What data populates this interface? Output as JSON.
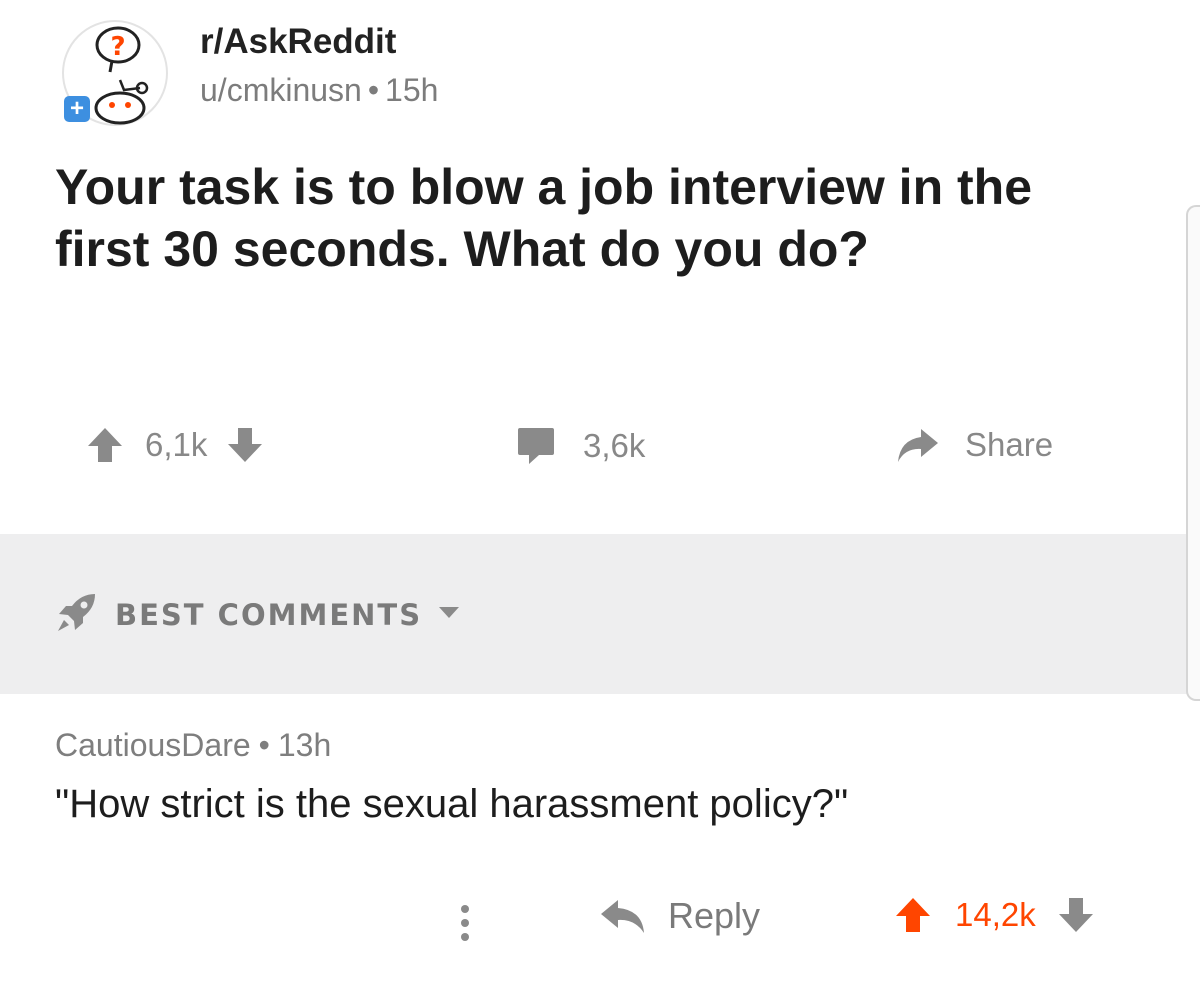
{
  "post": {
    "subreddit": "r/AskReddit",
    "author": "u/cmkinusn",
    "separator": "•",
    "age": "15h",
    "title": "Your task is to blow a job interview in the first 30 seconds. What do you do?",
    "score": "6,1k",
    "comments_count": "3,6k",
    "share_label": "Share"
  },
  "sort": {
    "label": "BEST COMMENTS"
  },
  "comment": {
    "author": "CautiousDare",
    "separator": "•",
    "age": "13h",
    "body": "\"How strict is the sexual harassment policy?\"",
    "reply_label": "Reply",
    "score": "14,2k"
  },
  "colors": {
    "upvote_active": "#ff4500",
    "icon_gray": "#8a8a8a",
    "sort_bar_bg": "#eeeeef",
    "plus_badge": "#3d8fe0"
  },
  "icons": {
    "avatar": "subreddit-avatar-icon",
    "plus": "plus-icon",
    "upvote": "upvote-arrow-icon",
    "downvote": "downvote-arrow-icon",
    "comment": "comment-bubble-icon",
    "share": "share-arrow-icon",
    "sort": "rocket-icon",
    "caret": "caret-down-icon",
    "more": "more-options-icon",
    "reply": "reply-arrow-icon"
  }
}
